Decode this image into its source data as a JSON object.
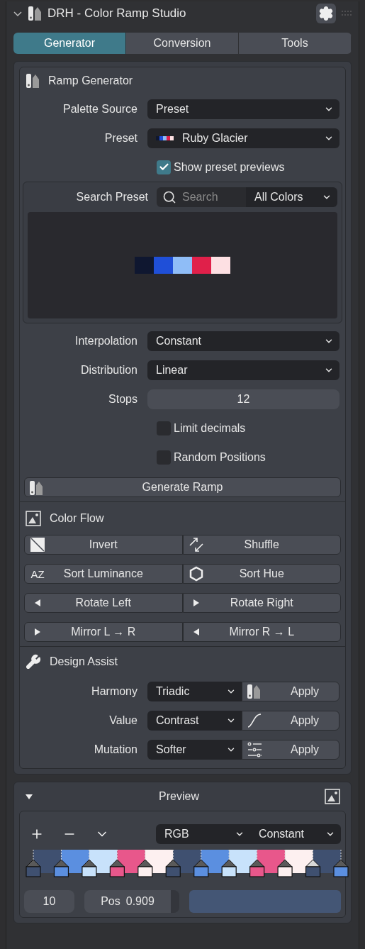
{
  "header": {
    "title": "DRH - Color Ramp Studio",
    "expanded": true
  },
  "tabs": [
    {
      "label": "Generator",
      "selected": true
    },
    {
      "label": "Conversion",
      "selected": false
    },
    {
      "label": "Tools",
      "selected": false
    }
  ],
  "ramp_generator": {
    "title": "Ramp Generator",
    "top_fields": [
      {
        "label": "Palette Source",
        "value": "Preset"
      },
      {
        "label": "Preset",
        "value": "Ruby Glacier",
        "swatch": [
          {
            "color": "#0f1730"
          },
          {
            "color": "#1f4fd8"
          },
          {
            "color": "#8fbdf7"
          },
          {
            "color": "#e0204a"
          },
          {
            "color": "#fde0e3"
          }
        ]
      }
    ],
    "show_previews": {
      "label": "Show preset previews",
      "checked": true
    },
    "search": {
      "label": "Search Preset",
      "placeholder": "Search",
      "filter": "All Colors"
    },
    "palette": [
      {
        "color": "#0f1730"
      },
      {
        "color": "#1f4fd8"
      },
      {
        "color": "#8fbdf7"
      },
      {
        "color": "#e0204a"
      },
      {
        "color": "#fde0e3"
      }
    ],
    "fields": [
      {
        "label": "Interpolation",
        "value": "Constant"
      },
      {
        "label": "Distribution",
        "value": "Linear"
      }
    ],
    "stops": {
      "label": "Stops",
      "value": "12"
    },
    "options": [
      {
        "label": "Limit decimals",
        "checked": false
      },
      {
        "label": "Random Positions",
        "checked": false
      }
    ],
    "generate": "Generate Ramp"
  },
  "color_flow": {
    "title": "Color Flow",
    "buttons": [
      [
        {
          "label": "Invert",
          "kind": "invert"
        },
        {
          "label": "Shuffle",
          "kind": "shuffle"
        }
      ],
      [
        {
          "label": "Sort Luminance",
          "kind": "text",
          "icon_text": "AZ"
        },
        {
          "label": "Sort Hue",
          "kind": "hexagon"
        }
      ],
      [
        {
          "label": "Rotate Left",
          "kind": "left"
        },
        {
          "label": "Rotate Right",
          "kind": "right"
        }
      ],
      [
        {
          "label": "Mirror L → R",
          "kind": "right"
        },
        {
          "label": "Mirror R → L",
          "kind": "left"
        }
      ]
    ]
  },
  "design_assist": {
    "title": "Design Assist",
    "rows": [
      {
        "label": "Harmony",
        "value": "Triadic",
        "button": "Apply",
        "kind": "swatch"
      },
      {
        "label": "Value",
        "value": "Contrast",
        "button": "Apply",
        "kind": "curve"
      },
      {
        "label": "Mutation",
        "value": "Softer",
        "button": "Apply",
        "kind": "sliders"
      }
    ]
  },
  "preview": {
    "title": "Preview",
    "expanded": true,
    "color_mode": "RGB",
    "interpolation": "Constant",
    "stops": [
      {
        "color": "#3f5070",
        "selected": false
      },
      {
        "color": "#5b8fe0",
        "selected": false
      },
      {
        "color": "#c8e2fb",
        "selected": false
      },
      {
        "color": "#e8578b",
        "selected": false
      },
      {
        "color": "#fdf0f0",
        "selected": false
      },
      {
        "color": "#3f5070",
        "selected": false
      },
      {
        "color": "#5b8fe0",
        "selected": false
      },
      {
        "color": "#c8e2fb",
        "selected": false
      },
      {
        "color": "#e8578b",
        "selected": false
      },
      {
        "color": "#fdf0f0",
        "selected": false
      },
      {
        "color": "#3f5070",
        "selected": true
      },
      {
        "color": "#5b8fe0",
        "selected": false
      }
    ],
    "index": "10",
    "pos_label": "Pos",
    "pos_value": "0.909",
    "active": {
      "color": "#445675"
    }
  }
}
